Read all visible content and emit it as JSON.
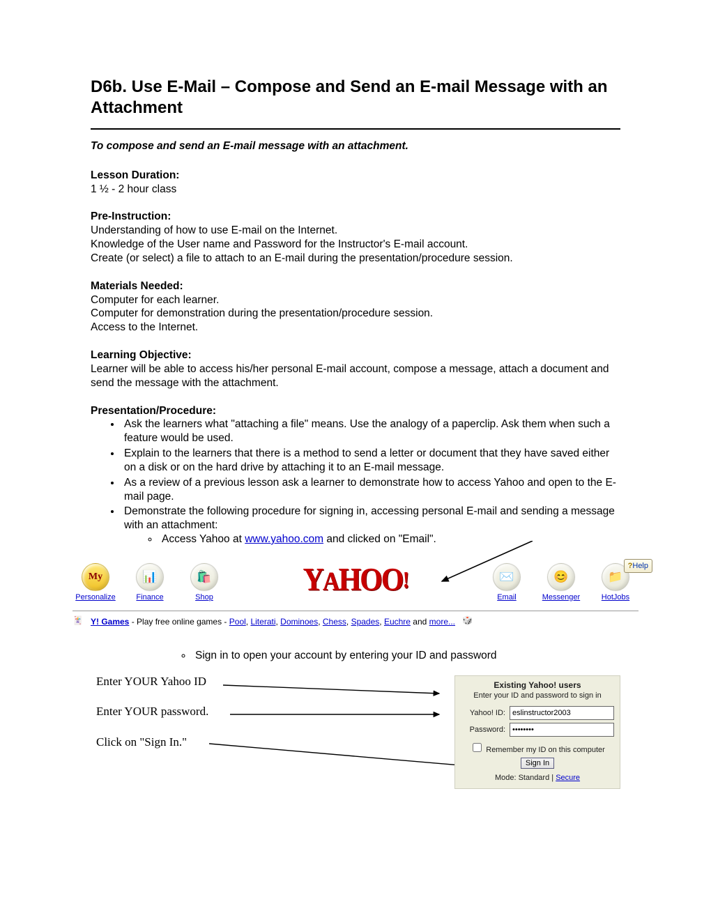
{
  "title": "D6b. Use E-Mail – Compose and Send an E-mail Message with an Attachment",
  "intro": "To compose and send an E-mail message with an attachment.",
  "duration_h": "Lesson Duration:",
  "duration": "1 ½  - 2 hour class",
  "preinstr_h": "Pre-Instruction:",
  "preinstr_lines": [
    "Understanding of how to use E-mail on the Internet.",
    "Knowledge of the User name and Password for the Instructor's E-mail account.",
    "Create (or select) a file to attach to an E-mail during the presentation/procedure session."
  ],
  "materials_h": "Materials Needed:",
  "materials_lines": [
    "Computer for each learner.",
    "Computer for demonstration during the presentation/procedure session.",
    "Access to the Internet."
  ],
  "objective_h": "Learning Objective:",
  "objective": "Learner will be able to access his/her personal E-mail account, compose a message, attach a document and send the message with the attachment.",
  "procedure_h": "Presentation/Procedure:",
  "procedure_items": [
    "Ask the learners what \"attaching a file\" means.  Use the analogy of a paperclip.  Ask them when such a feature would be used.",
    "Explain to the learners that there is a method to send a letter or document that they have saved either on a disk or on the hard drive by attaching it to an E-mail message.",
    "As a review of a previous lesson ask a learner to demonstrate how to access Yahoo and open to the E-mail page.",
    "Demonstrate the following procedure for signing in, accessing personal E-mail and sending a message with an attachment:"
  ],
  "sub_access_pre": "Access Yahoo at ",
  "sub_access_link": "www.yahoo.com",
  "sub_access_post": " and clicked on \"Email\".",
  "yahoo": {
    "help": "Help",
    "brand_text": "YAHOO!",
    "icons": [
      {
        "label": "Personalize",
        "glyph": "My",
        "bg": "linear-gradient(#ffe978,#f0c228)",
        "fg": "#8a0000",
        "fw": "bold",
        "fs": "14px",
        "ff": "'Brush Script MT',cursive"
      },
      {
        "label": "Finance",
        "glyph": "📊",
        "bg": "linear-gradient(#f8f8f0,#e8e8d8)"
      },
      {
        "label": "Shop",
        "glyph": "🛍️",
        "bg": "linear-gradient(#f8f8f0,#e8e8d8)"
      }
    ],
    "icons_right": [
      {
        "label": "Email",
        "glyph": "✉️",
        "bg": "linear-gradient(#f8f8f0,#e8e8d8)"
      },
      {
        "label": "Messenger",
        "glyph": "😊",
        "bg": "linear-gradient(#f8f8f0,#e8e8d8)"
      },
      {
        "label": "HotJobs",
        "glyph": "📁",
        "bg": "linear-gradient(#f8f8f0,#e8e8d8)"
      }
    ]
  },
  "games": {
    "lead": "Y! Games",
    "mid": " - Play free online games - ",
    "links": [
      "Pool",
      "Literati",
      "Dominoes",
      "Chess",
      "Spades",
      "Euchre"
    ],
    "and_text": " and ",
    "more": "more..."
  },
  "sub_signin": "Sign in to open your account by entering your ID and password",
  "instr_lines": [
    "Enter YOUR Yahoo ID",
    "Enter YOUR password.",
    "Click on \"Sign In.\""
  ],
  "signin_box": {
    "title": "Existing Yahoo! users",
    "subtitle": "Enter your ID and password to sign in",
    "id_label": "Yahoo! ID:",
    "id_value": "eslinstructor2003",
    "pw_label": "Password:",
    "pw_value": "••••••••",
    "remember": " Remember my ID on this computer",
    "signin_btn": "Sign In",
    "mode_lead": "Mode: Standard | ",
    "mode_link": "Secure"
  }
}
